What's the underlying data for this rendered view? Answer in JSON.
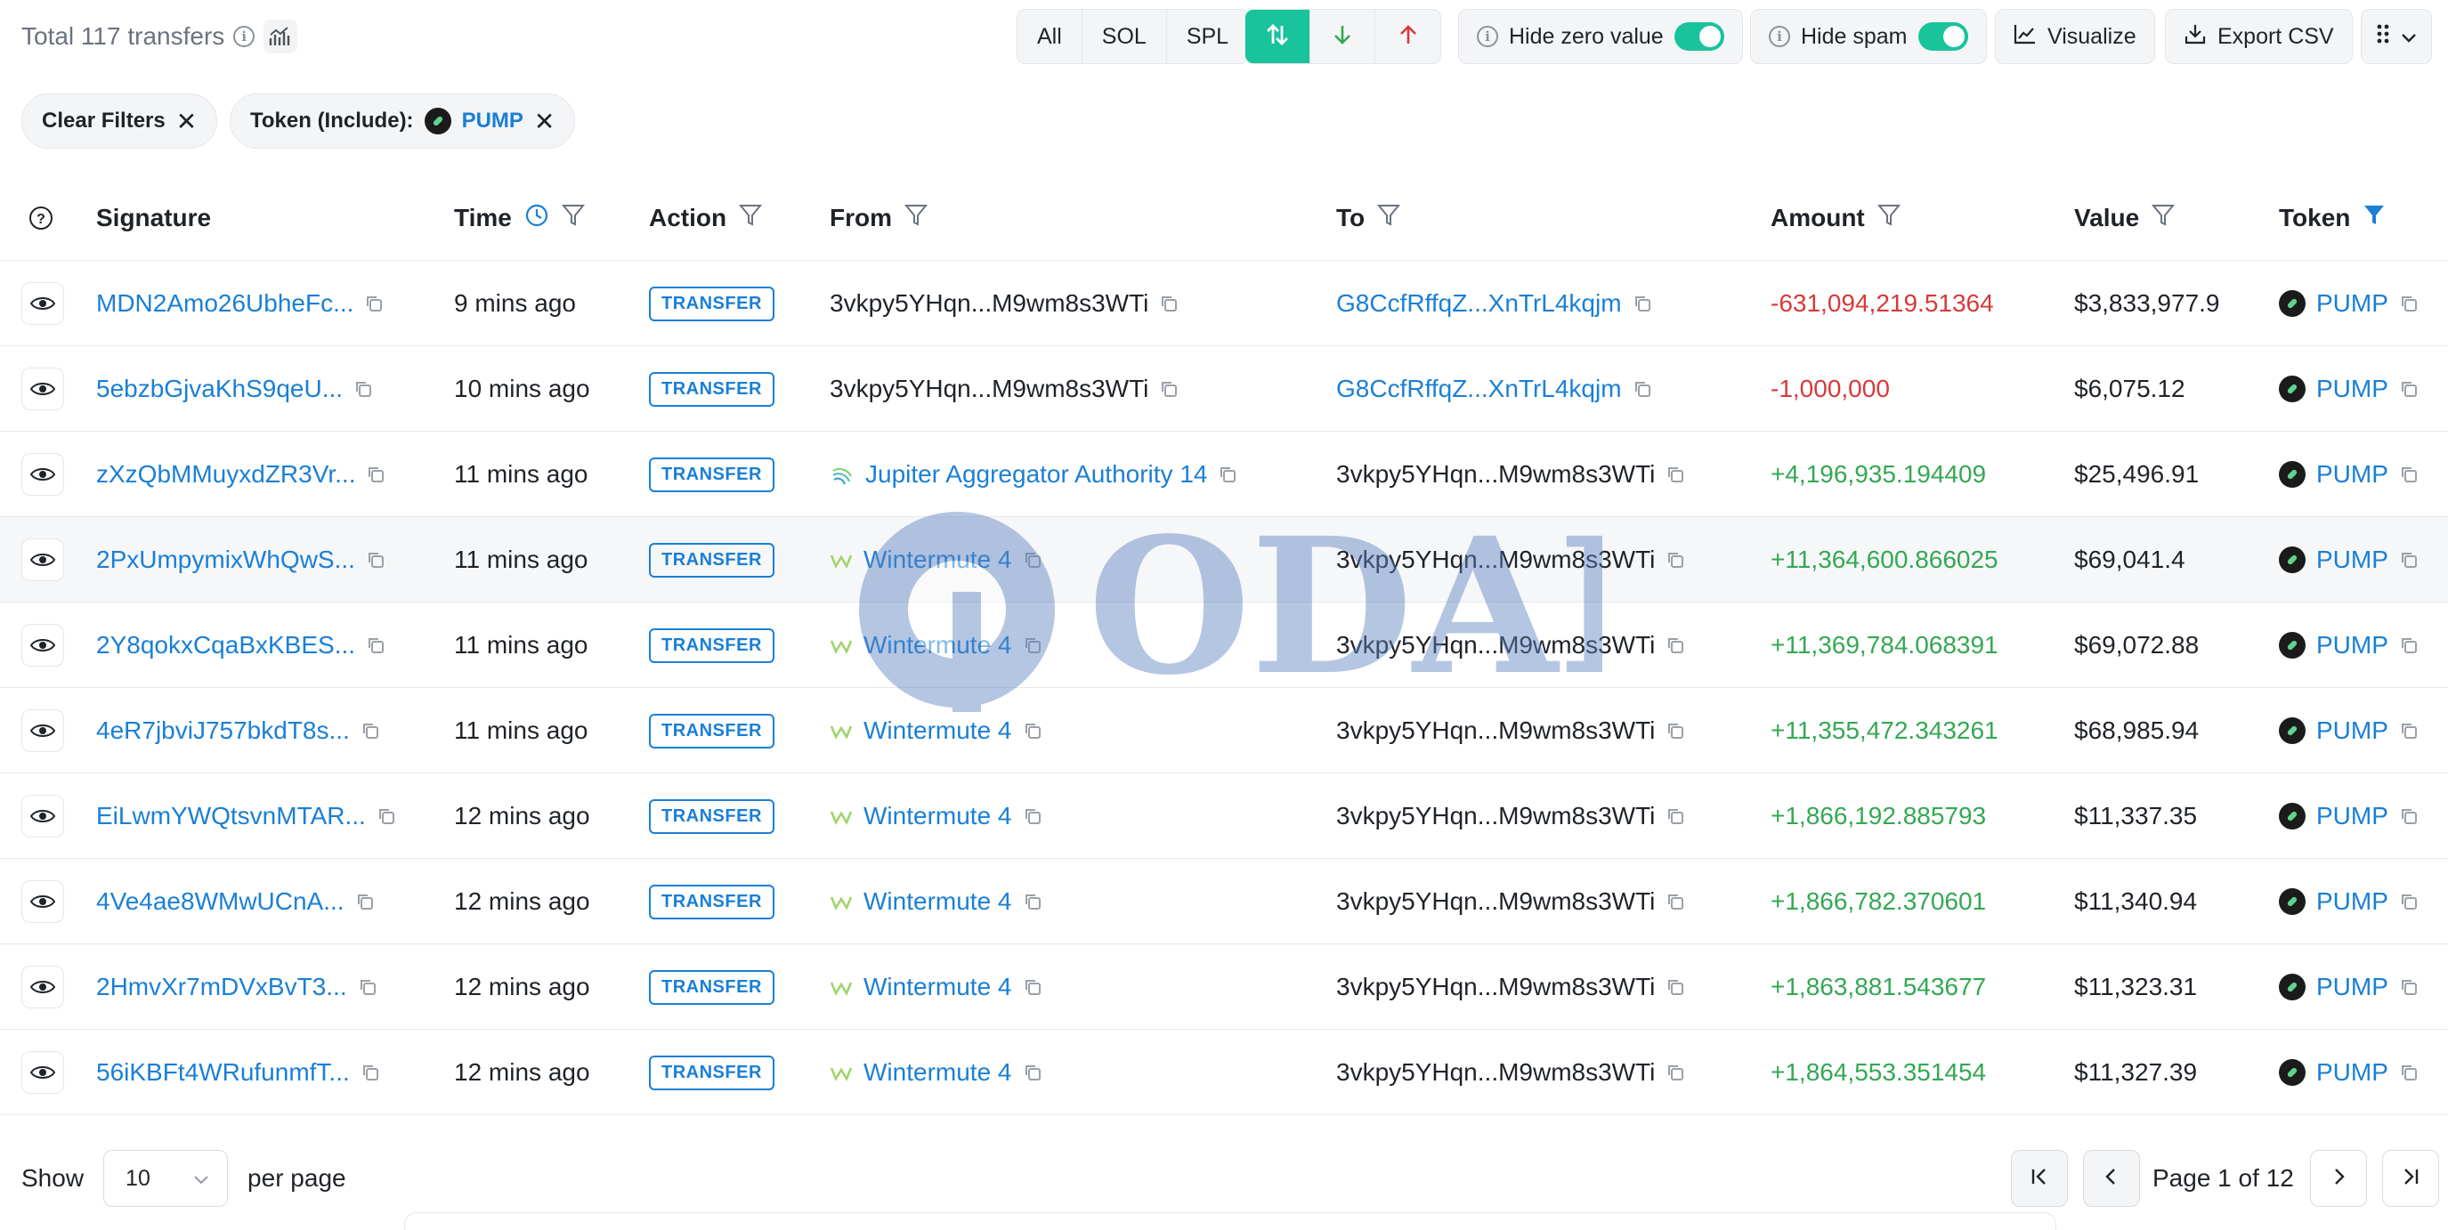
{
  "header": {
    "total_text": "Total 117 transfers",
    "filters": [
      "All",
      "SOL",
      "SPL"
    ],
    "hide_zero_label": "Hide zero value",
    "hide_zero_on": true,
    "hide_spam_label": "Hide spam",
    "hide_spam_on": true,
    "visualize_label": "Visualize",
    "export_label": "Export CSV"
  },
  "filter_chips": {
    "clear_label": "Clear Filters",
    "token_label": "Token (Include):",
    "token_value": "PUMP"
  },
  "columns": {
    "signature": "Signature",
    "time": "Time",
    "action": "Action",
    "from": "From",
    "to": "To",
    "amount": "Amount",
    "value": "Value",
    "token": "Token"
  },
  "rows": [
    {
      "signature": "MDN2Amo26UbheFc...",
      "time": "9 mins ago",
      "action": "TRANSFER",
      "from": "3vkpy5YHqn...M9wm8s3WTi",
      "from_link": false,
      "from_icon": "",
      "to": "G8CcfRffqZ...XnTrL4kqjm",
      "to_link": true,
      "amount": "-631,094,219.51364",
      "amount_sign": "neg",
      "value": "$3,833,977.9",
      "token": "PUMP"
    },
    {
      "signature": "5ebzbGjvaKhS9qeU...",
      "time": "10 mins ago",
      "action": "TRANSFER",
      "from": "3vkpy5YHqn...M9wm8s3WTi",
      "from_link": false,
      "from_icon": "",
      "to": "G8CcfRffqZ...XnTrL4kqjm",
      "to_link": true,
      "amount": "-1,000,000",
      "amount_sign": "neg",
      "value": "$6,075.12",
      "token": "PUMP"
    },
    {
      "signature": "zXzQbMMuyxdZR3Vr...",
      "time": "11 mins ago",
      "action": "TRANSFER",
      "from": "Jupiter Aggregator Authority 14",
      "from_link": true,
      "from_icon": "jupiter",
      "to": "3vkpy5YHqn...M9wm8s3WTi",
      "to_link": false,
      "amount": "+4,196,935.194409",
      "amount_sign": "pos",
      "value": "$25,496.91",
      "token": "PUMP"
    },
    {
      "signature": "2PxUmpymixWhQwS...",
      "time": "11 mins ago",
      "action": "TRANSFER",
      "from": "Wintermute 4",
      "from_link": true,
      "from_icon": "wintermute",
      "to": "3vkpy5YHqn...M9wm8s3WTi",
      "to_link": false,
      "amount": "+11,364,600.866025",
      "amount_sign": "pos",
      "value": "$69,041.4",
      "token": "PUMP"
    },
    {
      "signature": "2Y8qokxCqaBxKBES...",
      "time": "11 mins ago",
      "action": "TRANSFER",
      "from": "Wintermute 4",
      "from_link": true,
      "from_icon": "wintermute",
      "to": "3vkpy5YHqn...M9wm8s3WTi",
      "to_link": false,
      "amount": "+11,369,784.068391",
      "amount_sign": "pos",
      "value": "$69,072.88",
      "token": "PUMP"
    },
    {
      "signature": "4eR7jbviJ757bkdT8s...",
      "time": "11 mins ago",
      "action": "TRANSFER",
      "from": "Wintermute 4",
      "from_link": true,
      "from_icon": "wintermute",
      "to": "3vkpy5YHqn...M9wm8s3WTi",
      "to_link": false,
      "amount": "+11,355,472.343261",
      "amount_sign": "pos",
      "value": "$68,985.94",
      "token": "PUMP"
    },
    {
      "signature": "EiLwmYWQtsvnMTAR...",
      "time": "12 mins ago",
      "action": "TRANSFER",
      "from": "Wintermute 4",
      "from_link": true,
      "from_icon": "wintermute",
      "to": "3vkpy5YHqn...M9wm8s3WTi",
      "to_link": false,
      "amount": "+1,866,192.885793",
      "amount_sign": "pos",
      "value": "$11,337.35",
      "token": "PUMP"
    },
    {
      "signature": "4Ve4ae8WMwUCnA...",
      "time": "12 mins ago",
      "action": "TRANSFER",
      "from": "Wintermute 4",
      "from_link": true,
      "from_icon": "wintermute",
      "to": "3vkpy5YHqn...M9wm8s3WTi",
      "to_link": false,
      "amount": "+1,866,782.370601",
      "amount_sign": "pos",
      "value": "$11,340.94",
      "token": "PUMP"
    },
    {
      "signature": "2HmvXr7mDVxBvT3...",
      "time": "12 mins ago",
      "action": "TRANSFER",
      "from": "Wintermute 4",
      "from_link": true,
      "from_icon": "wintermute",
      "to": "3vkpy5YHqn...M9wm8s3WTi",
      "to_link": false,
      "amount": "+1,863,881.543677",
      "amount_sign": "pos",
      "value": "$11,323.31",
      "token": "PUMP"
    },
    {
      "signature": "56iKBFt4WRufunmfT...",
      "time": "12 mins ago",
      "action": "TRANSFER",
      "from": "Wintermute 4",
      "from_link": true,
      "from_icon": "wintermute",
      "to": "3vkpy5YHqn...M9wm8s3WTi",
      "to_link": false,
      "amount": "+1,864,553.351454",
      "amount_sign": "pos",
      "value": "$11,327.39",
      "token": "PUMP"
    }
  ],
  "footer": {
    "show_label": "Show",
    "page_size": "10",
    "per_page_label": "per page",
    "page_text": "Page 1 of 12"
  },
  "watermark_text": "ODAILY",
  "colors": {
    "accent_green": "#19c39b",
    "link_blue": "#1a7fd6",
    "negative_red": "#d63a3a",
    "positive_green": "#34a853"
  }
}
